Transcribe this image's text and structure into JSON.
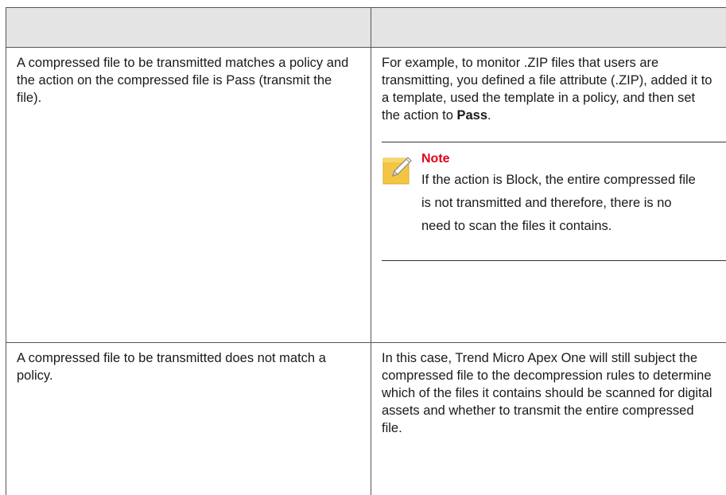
{
  "table": {
    "header": [
      "",
      ""
    ],
    "rows": [
      {
        "condition": "A compressed file to be transmitted matches a policy and the action on the compressed file is Pass (transmit the file).",
        "description_prefix": "For example, to monitor .ZIP files that users are transmitting, you defined a file attribute (.ZIP), added it to a template, used the template in a policy, and then set the action to ",
        "description_bold": "Pass",
        "description_suffix": ".",
        "note": {
          "icon": "note-pencil-icon",
          "title": "Note",
          "text": "If the action is Block, the entire compressed file is not transmitted and therefore, there is no need to scan the files it contains."
        }
      },
      {
        "condition": "A compressed file to be transmitted does not match a policy.",
        "description": "In this case, Trend Micro Apex One will still subject the compressed file to the decompression rules to determine which of the files it contains should be scanned for digital assets and whether to transmit the entire compressed file."
      }
    ]
  },
  "colors": {
    "header_bg": "#e4e4e4",
    "note_title": "#e2001a",
    "note_icon": "#f4c542"
  }
}
